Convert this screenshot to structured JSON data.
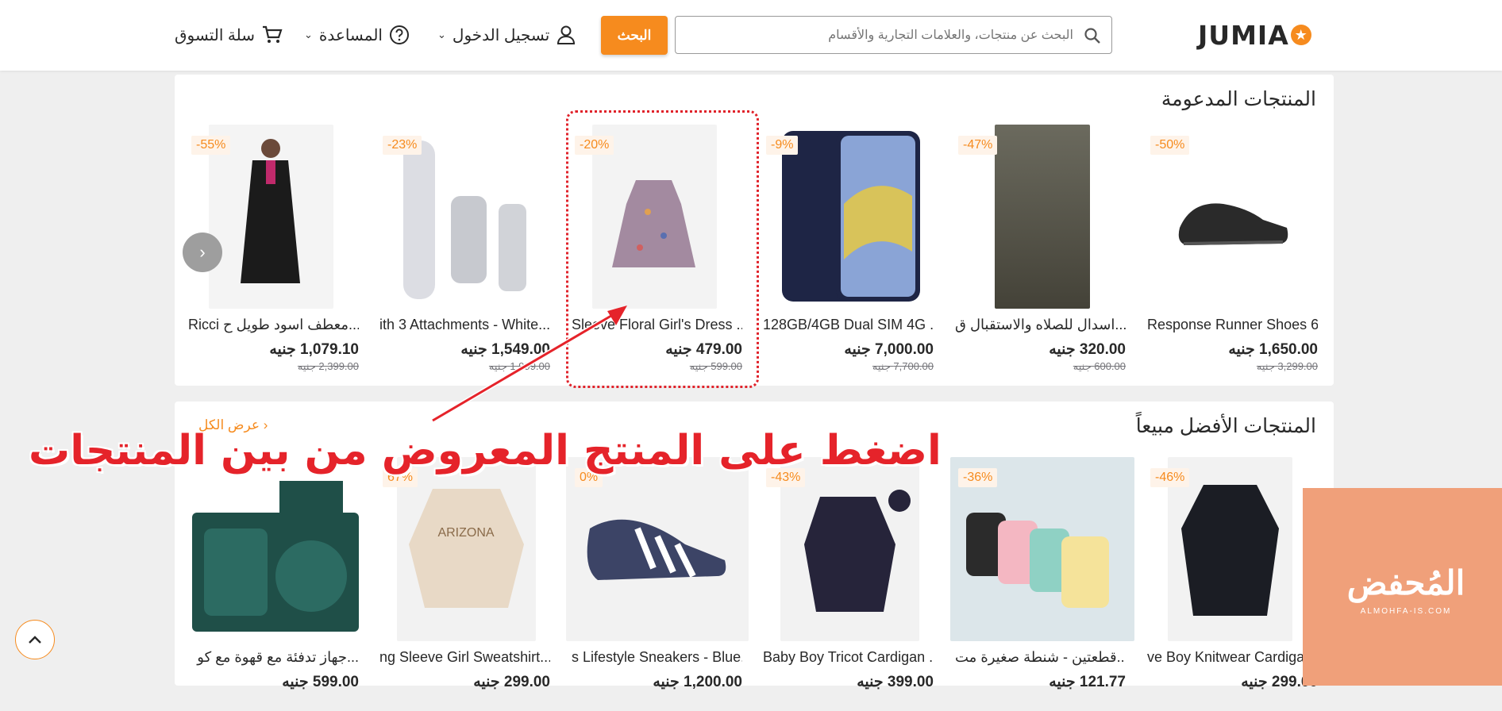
{
  "header": {
    "logo_text": "JUMIA",
    "search_placeholder": "البحث عن منتجات، والعلامات التجارية والأقسام",
    "search_button": "البحث",
    "account_label": "تسجيل الدخول",
    "help_label": "المساعدة",
    "cart_label": "سلة التسوق"
  },
  "sponsored": {
    "title": "المنتجات المدعومة",
    "products": [
      {
        "name": "Response Runner Shoes 6...",
        "price": "1,650.00 جنيه",
        "old_price": "3,299.00 جنيه",
        "discount": "-50%",
        "icon": "shoe-image",
        "color": "#2a2a2a"
      },
      {
        "name": "اسدال للصلاه والاستقبال ق...",
        "price": "320.00 جنيه",
        "old_price": "600.00 جنيه",
        "discount": "-47%",
        "icon": "prayer-dress-image",
        "color": "#5b5a4e"
      },
      {
        "name": "128GB/4GB Dual SIM 4G ...",
        "price": "7,000.00 جنيه",
        "old_price": "7,700.00 جنيه",
        "discount": "-9%",
        "icon": "phone-image",
        "color": "#1e2545"
      },
      {
        "name": "Sleeve Floral Girl's Dress ...",
        "price": "479.00 جنيه",
        "old_price": "599.00 جنيه",
        "discount": "-20%",
        "icon": "dress-image",
        "color": "#a38aa0"
      },
      {
        "name": "ith 3 Attachments - White...",
        "price": "1,549.00 جنيه",
        "old_price": "1,999.00 جنيه",
        "discount": "-23%",
        "icon": "hair-dryer-image",
        "color": "#dcdde3"
      },
      {
        "name": "Ricci معطف اسود طويل ح...",
        "price": "1,079.10 جنيه",
        "old_price": "2,399.00 جنيه",
        "discount": "-55%",
        "icon": "coat-image",
        "color": "#1b1b1b"
      }
    ]
  },
  "best_sellers": {
    "title": "المنتجات الأفضل مبيعاً",
    "see_all": "عرض الكل",
    "products": [
      {
        "name": "ve Boy Knitwear Cardigan...",
        "price": "299.00 جنيه",
        "discount": "-46%",
        "icon": "cardigan-image",
        "color": "#1b1d24"
      },
      {
        "name": "قطعتين - شنطة صغيرة مت...",
        "price": "121.77 جنيه",
        "discount": "-36%",
        "icon": "bags-image",
        "color": "#dce6ea"
      },
      {
        "name": "Baby Boy Tricot Cardigan ...",
        "price": "399.00 جنيه",
        "discount": "-43%",
        "icon": "baby-cardigan-image",
        "color": "#26243a"
      },
      {
        "name": "s Lifestyle Sneakers - Blue...",
        "price": "1,200.00 جنيه",
        "discount": "0%",
        "icon": "sneakers-image",
        "color": "#3c4466"
      },
      {
        "name": "ng Sleeve Girl Sweatshirt...",
        "price": "299.00 جنيه",
        "discount": "67%",
        "icon": "sweatshirt-image",
        "color": "#e8d9c6"
      },
      {
        "name": "جهاز تدفئة مع قهوة مع كو...",
        "price": "599.00 جنيه",
        "discount": "",
        "icon": "mug-warmer-image",
        "color": "#1f4f48"
      }
    ]
  },
  "annotation": {
    "instruction_text": "اضغط على المنتج المعروض من بين المنتجات"
  },
  "watermark": {
    "text": "المُحفض",
    "sub": "ALMOHFA-IS.COM"
  },
  "colors": {
    "accent": "#f68b1e",
    "annotation_red": "#e5232a"
  }
}
